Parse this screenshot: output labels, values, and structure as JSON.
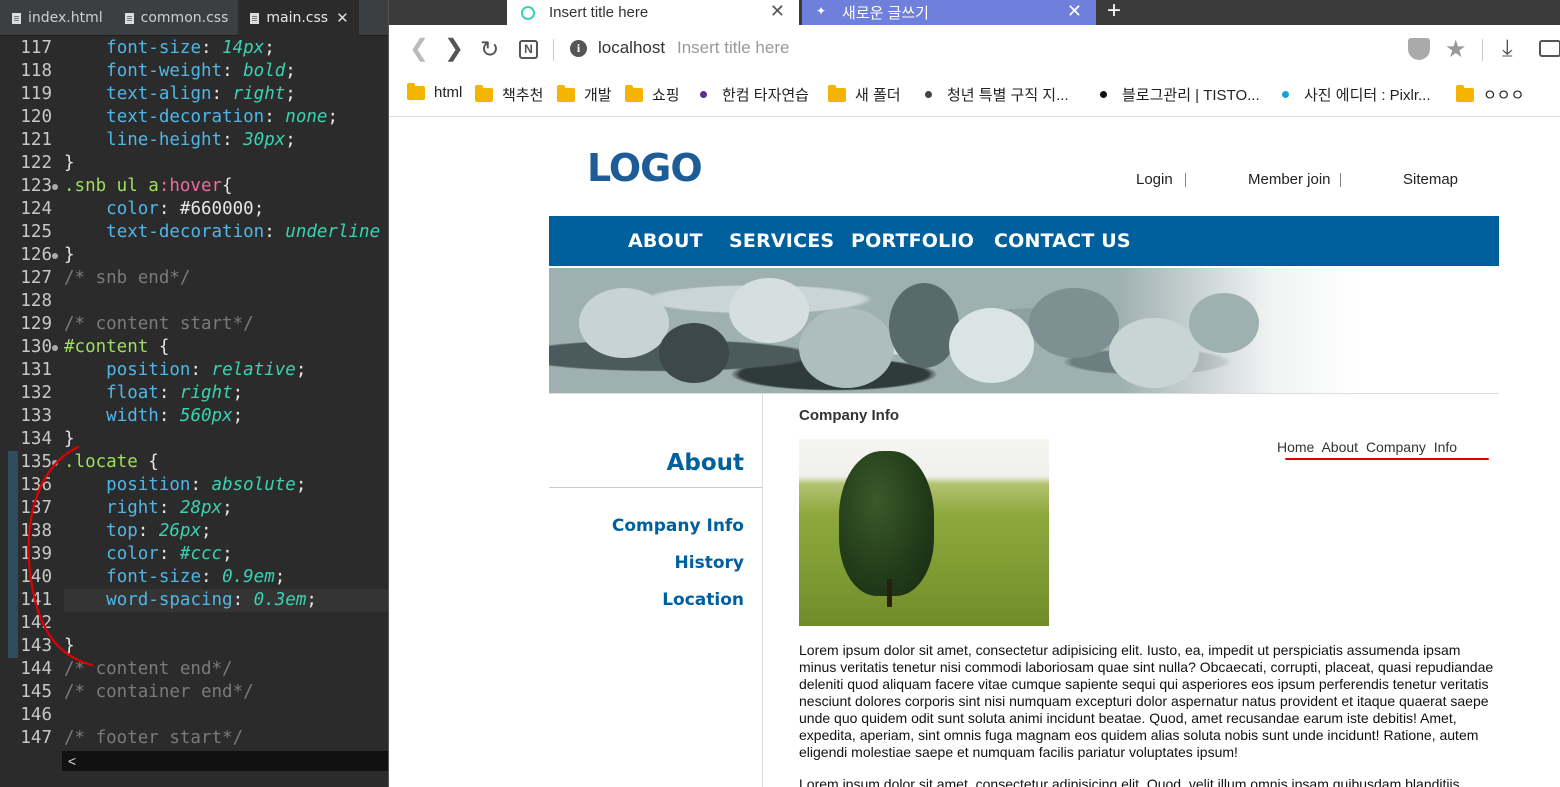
{
  "editor": {
    "tabs": [
      {
        "label": "index.html"
      },
      {
        "label": "common.css"
      },
      {
        "label": "main.css",
        "close": "✕"
      }
    ],
    "lines": [
      {
        "num": "117",
        "parts": [
          [
            "    ",
            ""
          ],
          [
            "font-size",
            "t-prop"
          ],
          [
            ": ",
            "t-col"
          ],
          [
            "14px",
            "t-val"
          ],
          [
            ";",
            "t-col"
          ]
        ]
      },
      {
        "num": "118",
        "parts": [
          [
            "    ",
            ""
          ],
          [
            "font-weight",
            "t-prop"
          ],
          [
            ": ",
            "t-col"
          ],
          [
            "bold",
            "t-val"
          ],
          [
            ";",
            "t-col"
          ]
        ]
      },
      {
        "num": "119",
        "parts": [
          [
            "    ",
            ""
          ],
          [
            "text-align",
            "t-prop"
          ],
          [
            ": ",
            "t-col"
          ],
          [
            "right",
            "t-val"
          ],
          [
            ";",
            "t-col"
          ]
        ]
      },
      {
        "num": "120",
        "parts": [
          [
            "    ",
            ""
          ],
          [
            "text-decoration",
            "t-prop"
          ],
          [
            ": ",
            "t-col"
          ],
          [
            "none",
            "t-val"
          ],
          [
            ";",
            "t-col"
          ]
        ]
      },
      {
        "num": "121",
        "parts": [
          [
            "    ",
            ""
          ],
          [
            "line-height",
            "t-prop"
          ],
          [
            ": ",
            "t-col"
          ],
          [
            "30px",
            "t-val"
          ],
          [
            ";",
            "t-col"
          ]
        ]
      },
      {
        "num": "122",
        "parts": [
          [
            "}",
            "t-col"
          ]
        ]
      },
      {
        "num": "123",
        "dot": true,
        "parts": [
          [
            ".snb ul a",
            "t-sel"
          ],
          [
            ":hover",
            "t-hover"
          ],
          [
            "{",
            "t-col"
          ]
        ]
      },
      {
        "num": "124",
        "parts": [
          [
            "    ",
            ""
          ],
          [
            "color",
            "t-prop"
          ],
          [
            ": ",
            "t-col"
          ],
          [
            "#660000",
            "t-col"
          ],
          [
            ";",
            "t-col"
          ]
        ]
      },
      {
        "num": "125",
        "parts": [
          [
            "    ",
            ""
          ],
          [
            "text-decoration",
            "t-prop"
          ],
          [
            ": ",
            "t-col"
          ],
          [
            "underline",
            "t-val"
          ]
        ]
      },
      {
        "num": "126",
        "dot": true,
        "parts": [
          [
            "}",
            "t-col"
          ]
        ]
      },
      {
        "num": "127",
        "parts": [
          [
            "/* snb end*/",
            "t-cm"
          ]
        ]
      },
      {
        "num": "128",
        "parts": []
      },
      {
        "num": "129",
        "parts": [
          [
            "/* content start*/",
            "t-cm"
          ]
        ]
      },
      {
        "num": "130",
        "dot": true,
        "parts": [
          [
            "#content",
            "t-sel"
          ],
          [
            " {",
            "t-col"
          ]
        ]
      },
      {
        "num": "131",
        "parts": [
          [
            "    ",
            ""
          ],
          [
            "position",
            "t-prop"
          ],
          [
            ": ",
            "t-col"
          ],
          [
            "relative",
            "t-val"
          ],
          [
            ";",
            "t-col"
          ]
        ]
      },
      {
        "num": "132",
        "parts": [
          [
            "    ",
            ""
          ],
          [
            "float",
            "t-prop"
          ],
          [
            ": ",
            "t-col"
          ],
          [
            "right",
            "t-val"
          ],
          [
            ";",
            "t-col"
          ]
        ]
      },
      {
        "num": "133",
        "parts": [
          [
            "    ",
            ""
          ],
          [
            "width",
            "t-prop"
          ],
          [
            ": ",
            "t-col"
          ],
          [
            "560px",
            "t-val"
          ],
          [
            ";",
            "t-col"
          ]
        ]
      },
      {
        "num": "134",
        "parts": [
          [
            "}",
            "t-col"
          ]
        ]
      },
      {
        "num": "135",
        "dot": true,
        "mark": true,
        "parts": [
          [
            ".locate",
            "t-sel"
          ],
          [
            " {",
            "t-col"
          ]
        ]
      },
      {
        "num": "136",
        "mark": true,
        "parts": [
          [
            "    ",
            ""
          ],
          [
            "position",
            "t-prop"
          ],
          [
            ": ",
            "t-col"
          ],
          [
            "absolute",
            "t-val"
          ],
          [
            ";",
            "t-col"
          ]
        ]
      },
      {
        "num": "137",
        "mark": true,
        "parts": [
          [
            "    ",
            ""
          ],
          [
            "right",
            "t-prop"
          ],
          [
            ": ",
            "t-col"
          ],
          [
            "28px",
            "t-val"
          ],
          [
            ";",
            "t-col"
          ]
        ]
      },
      {
        "num": "138",
        "mark": true,
        "parts": [
          [
            "    ",
            ""
          ],
          [
            "top",
            "t-prop"
          ],
          [
            ": ",
            "t-col"
          ],
          [
            "26px",
            "t-val"
          ],
          [
            ";",
            "t-col"
          ]
        ]
      },
      {
        "num": "139",
        "mark": true,
        "parts": [
          [
            "    ",
            ""
          ],
          [
            "color",
            "t-prop"
          ],
          [
            ": ",
            "t-col"
          ],
          [
            "#ccc",
            "t-val"
          ],
          [
            ";",
            "t-col"
          ]
        ]
      },
      {
        "num": "140",
        "mark": true,
        "parts": [
          [
            "    ",
            ""
          ],
          [
            "font-size",
            "t-prop"
          ],
          [
            ": ",
            "t-col"
          ],
          [
            "0.9em",
            "t-val"
          ],
          [
            ";",
            "t-col"
          ]
        ]
      },
      {
        "num": "141",
        "mark": true,
        "hl": true,
        "parts": [
          [
            "    ",
            ""
          ],
          [
            "word-spacing",
            "t-prop"
          ],
          [
            ": ",
            "t-col"
          ],
          [
            "0.3em",
            "t-val"
          ],
          [
            ";",
            "t-col"
          ]
        ]
      },
      {
        "num": "142",
        "mark": true,
        "parts": []
      },
      {
        "num": "143",
        "mark": true,
        "parts": [
          [
            "}",
            "t-col"
          ]
        ]
      },
      {
        "num": "144",
        "parts": [
          [
            "/* content end*/",
            "t-cm"
          ]
        ]
      },
      {
        "num": "145",
        "parts": [
          [
            "/* container end*/",
            "t-cm"
          ]
        ]
      },
      {
        "num": "146",
        "parts": []
      },
      {
        "num": "147",
        "parts": [
          [
            "/* footer start*/",
            "t-cm"
          ]
        ]
      }
    ],
    "scroll_arrow": "<"
  },
  "browser": {
    "tabs": [
      {
        "title": "Insert title here",
        "close": "✕"
      },
      {
        "title": "새로운 글쓰기",
        "close": "✕"
      }
    ],
    "new_tab": "+",
    "url": "localhost",
    "url_title": "Insert title here",
    "bookmarks": [
      {
        "label": "html",
        "icon": "folder"
      },
      {
        "label": "책추천",
        "icon": "folder"
      },
      {
        "label": "개발",
        "icon": "folder"
      },
      {
        "label": "쇼핑",
        "icon": "folder"
      },
      {
        "label": "한컴 타자연습",
        "icon": "dot",
        "color": "#5b2d8e"
      },
      {
        "label": "새 폴더",
        "icon": "folder"
      },
      {
        "label": "청년 특별 구직 지...",
        "icon": "dot",
        "color": "#444444"
      },
      {
        "label": "블로그관리 | TISTO...",
        "icon": "dot",
        "color": "#111111"
      },
      {
        "label": "사진 에디터 : Pixlr...",
        "icon": "dot",
        "color": "#1aa3d9"
      },
      {
        "label": "ㅇㅇㅇ",
        "icon": "folder"
      }
    ]
  },
  "site": {
    "logo": "LOGO",
    "util_links": [
      "Login",
      "Member join",
      "Sitemap"
    ],
    "gnb": [
      "ABOUT",
      "SERVICES",
      "PORTFOLIO",
      "CONTACT US"
    ],
    "snb": {
      "title": "About",
      "items": [
        "Company Info",
        "History",
        "Location"
      ]
    },
    "content": {
      "title": "Company Info",
      "locate": "Home  About  Company  Info",
      "para1": "Lorem ipsum dolor sit amet, consectetur adipisicing elit. Iusto, ea, impedit ut perspiciatis assumenda ipsam minus veritatis tenetur nisi commodi laboriosam quae sint nulla? Obcaecati, corrupti, placeat, quasi repudiandae deleniti quod aliquam facere vitae cumque sapiente sequi qui asperiores eos ipsum perferendis tenetur veritatis nesciunt dolores corporis sint nisi numquam excepturi dolor aspernatur natus provident et itaque quaerat saepe unde quo quidem odit sunt soluta animi incidunt beatae. Quod, amet recusandae earum iste debitis! Amet, expedita, aperiam, sint omnis fuga magnam eos quidem alias soluta nobis sunt unde incidunt! Ratione, autem eligendi molestiae saepe et numquam facilis pariatur voluptates ipsum!",
      "para2": "Lorem ipsum dolor sit amet, consectetur adipisicing elit. Quod, velit illum omnis ipsam quibusdam blanditiis"
    }
  },
  "colors": {
    "brand_blue": "#00609e",
    "annotation_red": "#e00000",
    "editor_bg": "#2b2b2b"
  }
}
